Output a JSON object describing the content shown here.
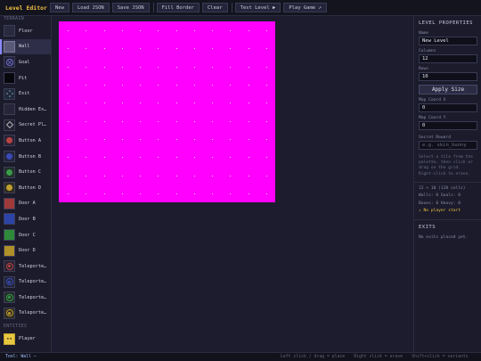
{
  "app": {
    "title": "Level Editor"
  },
  "toolbar": {
    "buttons": [
      "New",
      "Load JSON",
      "Save JSON",
      "Fill Border",
      "Clear",
      "Test Level ▶",
      "Play Game ↗"
    ]
  },
  "palette": {
    "terrain_title": "TERRAIN",
    "entities_title": "ENTITIES",
    "items": [
      {
        "label": "Floor"
      },
      {
        "label": "Wall"
      },
      {
        "label": "Goal"
      },
      {
        "label": "Pit"
      },
      {
        "label": "Exit"
      },
      {
        "label": "Hidden Exit"
      },
      {
        "label": "Secret Platform"
      },
      {
        "label": "Button A"
      },
      {
        "label": "Button B"
      },
      {
        "label": "Button C"
      },
      {
        "label": "Button D"
      },
      {
        "label": "Door A"
      },
      {
        "label": "Door B"
      },
      {
        "label": "Door C"
      },
      {
        "label": "Door D"
      },
      {
        "label": "Teleporter A"
      },
      {
        "label": "Teleporter B"
      },
      {
        "label": "Teleporter C"
      },
      {
        "label": "Teleporter D"
      }
    ],
    "entities": [
      {
        "label": "Player"
      }
    ],
    "selected": "Wall"
  },
  "grid": {
    "columns": 12,
    "rows": 10,
    "fill_color": "#ff00ff",
    "dot_color": "#fbd0fb"
  },
  "properties": {
    "title": "LEVEL PROPERTIES",
    "name_label": "Name",
    "name_value": "New Level",
    "columns_label": "Columns",
    "columns_value": "12",
    "rows_label": "Rows",
    "rows_value": "10",
    "apply_label": "Apply Size",
    "coordx_label": "Map Coord X",
    "coordx_value": "0",
    "coordy_label": "Map Coord Y",
    "coordy_value": "0",
    "reward_label": "Secret Reward",
    "reward_placeholder": "e.g. skin_bunny",
    "help_lines": [
      "Select a tile from the",
      "palette, then click or",
      "drag on the grid.",
      "Right-click to erase."
    ],
    "stats": {
      "size": "12 × 10  (120 cells)",
      "walls_goals": "Walls: 0  Goals: 0",
      "boxes_heavy": "Boxes: 0  Heavy: 0",
      "warning": "⚠ No player start"
    },
    "exits_title": "EXITS",
    "exits_empty": "No exits placed yet."
  },
  "status": {
    "tool": "Tool: Wall   —",
    "hints": [
      "Left click / drag = place",
      "Right click = erase",
      "Shift+click = variants"
    ]
  }
}
